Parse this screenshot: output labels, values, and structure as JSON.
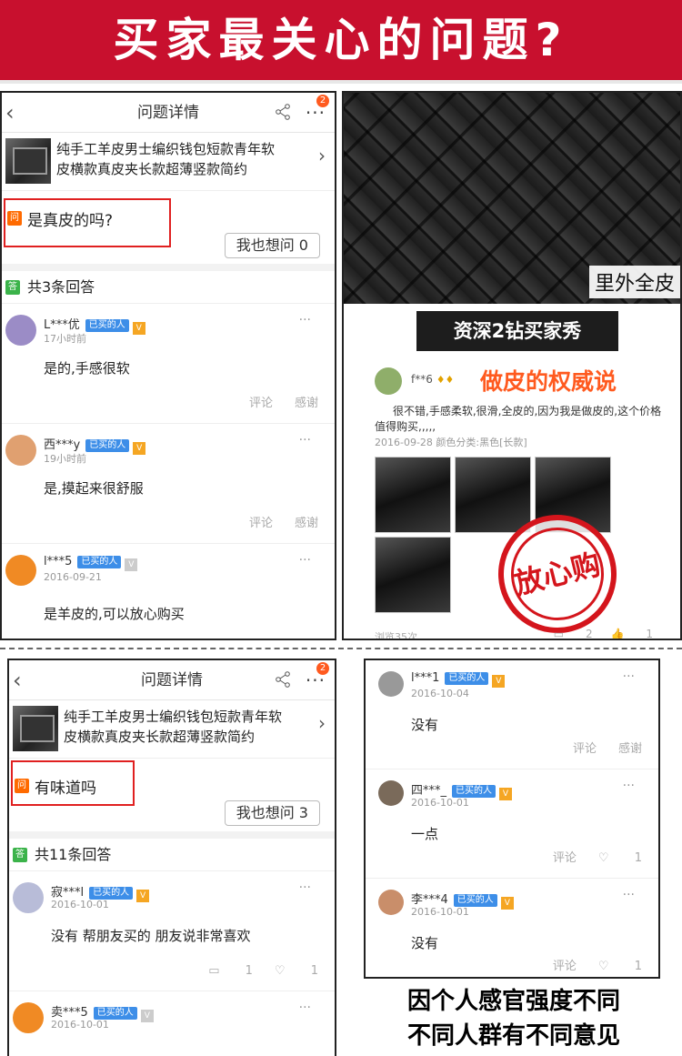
{
  "banner": {
    "title": "买家最关心的问题?"
  },
  "panel1": {
    "header": {
      "title": "问题详情",
      "back": "‹",
      "more": "···",
      "badge": "2"
    },
    "product": {
      "line1": "纯手工羊皮男士编织钱包短款青年软",
      "line2": "皮横款真皮夹长款超薄竖款简约",
      "chevron": "›"
    },
    "question": {
      "icon": "问",
      "text": "是真皮的吗?",
      "want_button": "我也想问 0"
    },
    "answer_count": {
      "icon": "答",
      "text": "共3条回答"
    },
    "answers": [
      {
        "name": "L***优",
        "tag": "已买的人",
        "time": "17小时前",
        "text": "是的,手感很软",
        "comment": "评论",
        "thanks": "感谢",
        "more": "···"
      },
      {
        "name": "西***y",
        "tag": "已买的人",
        "time": "19小时前",
        "text": "是,摸起来很舒服",
        "comment": "评论",
        "thanks": "感谢",
        "more": "···"
      },
      {
        "name": "l***5",
        "tag": "已买的人",
        "time": "2016-09-21",
        "text": "是羊皮的,可以放心购买",
        "more": "···"
      }
    ]
  },
  "panel2": {
    "photo_label": "里外全皮",
    "diamond_title": "资深2钻买家秀",
    "review": {
      "name": "f**6",
      "authority": "做皮的权威说",
      "text": "很不错,手感柔软,很滑,全皮的,因为我是做皮的,这个价格值得购买,,,,,",
      "meta": "2016-09-28 颜色分类:黑色[长款]",
      "views": "浏览35次",
      "comments": "2",
      "likes": "1"
    },
    "stamp": "放心购"
  },
  "panel3": {
    "header": {
      "title": "问题详情",
      "back": "‹",
      "more": "···",
      "badge": "2"
    },
    "product": {
      "line1": "纯手工羊皮男士编织钱包短款青年软",
      "line2": "皮横款真皮夹长款超薄竖款简约",
      "chevron": "›"
    },
    "question": {
      "icon": "问",
      "text": "有味道吗",
      "want_button": "我也想问 3"
    },
    "answer_count": {
      "icon": "答",
      "text": "共11条回答"
    },
    "answers": [
      {
        "name": "寂***l",
        "tag": "已买的人",
        "time": "2016-10-01",
        "text": "没有 帮朋友买的 朋友说非常喜欢",
        "comment": "1",
        "thanks": "1",
        "more": "···"
      },
      {
        "name": "卖***5",
        "tag": "已买的人",
        "time": "2016-10-01",
        "more": "···"
      }
    ]
  },
  "panel4": {
    "answers": [
      {
        "name": "l***1",
        "tag": "已买的人",
        "time": "2016-10-04",
        "text": "没有",
        "comment": "评论",
        "thanks": "感谢",
        "more": "···"
      },
      {
        "name": "四***_",
        "tag": "已买的人",
        "time": "2016-10-01",
        "text": "一点",
        "comment": "评论",
        "thanks": "1",
        "more": "···"
      },
      {
        "name": "李***4",
        "tag": "已买的人",
        "time": "2016-10-01",
        "text": "没有",
        "comment": "评论",
        "thanks": "1",
        "more": "···"
      }
    ]
  },
  "caption": {
    "line1": "因个人感官强度不同",
    "line2": "不同人群有不同意见"
  }
}
